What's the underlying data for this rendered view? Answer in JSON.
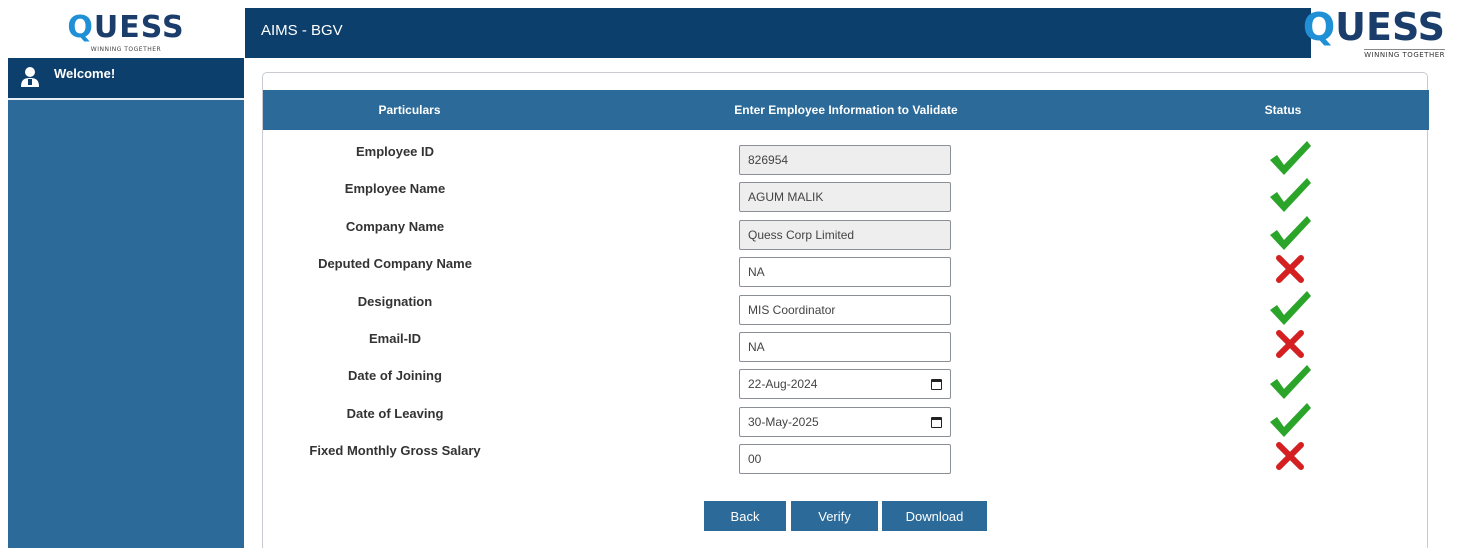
{
  "brand": {
    "left_logo_text": "QUESS",
    "left_logo_tagline": "WINNING TOGETHER",
    "right_logo_text": "QUESS",
    "right_logo_tagline": "WINNING TOGETHER"
  },
  "header": {
    "title": "AIMS - BGV"
  },
  "sidebar": {
    "welcome": "Welcome!"
  },
  "table": {
    "headers": {
      "particulars": "Particulars",
      "enter": "Enter Employee Information to Validate",
      "status": "Status"
    },
    "rows": [
      {
        "label": "Employee ID",
        "value": "826954",
        "readonly": true,
        "status": "valid"
      },
      {
        "label": "Employee Name",
        "value": "AGUM MALIK",
        "readonly": true,
        "status": "valid"
      },
      {
        "label": "Company Name",
        "value": "Quess Corp Limited",
        "readonly": true,
        "status": "valid"
      },
      {
        "label": "Deputed Company Name",
        "value": "NA",
        "readonly": false,
        "status": "invalid"
      },
      {
        "label": "Designation",
        "value": "MIS Coordinator",
        "readonly": false,
        "status": "valid"
      },
      {
        "label": "Email-ID",
        "value": "NA",
        "readonly": false,
        "status": "invalid"
      },
      {
        "label": "Date of Joining",
        "value": "22-Aug-2024",
        "readonly": false,
        "status": "valid",
        "type": "date"
      },
      {
        "label": "Date of Leaving",
        "value": "30-May-2025",
        "readonly": false,
        "status": "valid",
        "type": "date"
      },
      {
        "label": "Fixed Monthly Gross Salary",
        "value": "00",
        "readonly": false,
        "status": "invalid"
      }
    ]
  },
  "buttons": {
    "back": "Back",
    "verify": "Verify",
    "download": "Download"
  },
  "colors": {
    "header_bg": "#0d3f6c",
    "sidebar_bg": "#2c6a99",
    "valid": "#2aa52a",
    "invalid": "#d42020"
  }
}
